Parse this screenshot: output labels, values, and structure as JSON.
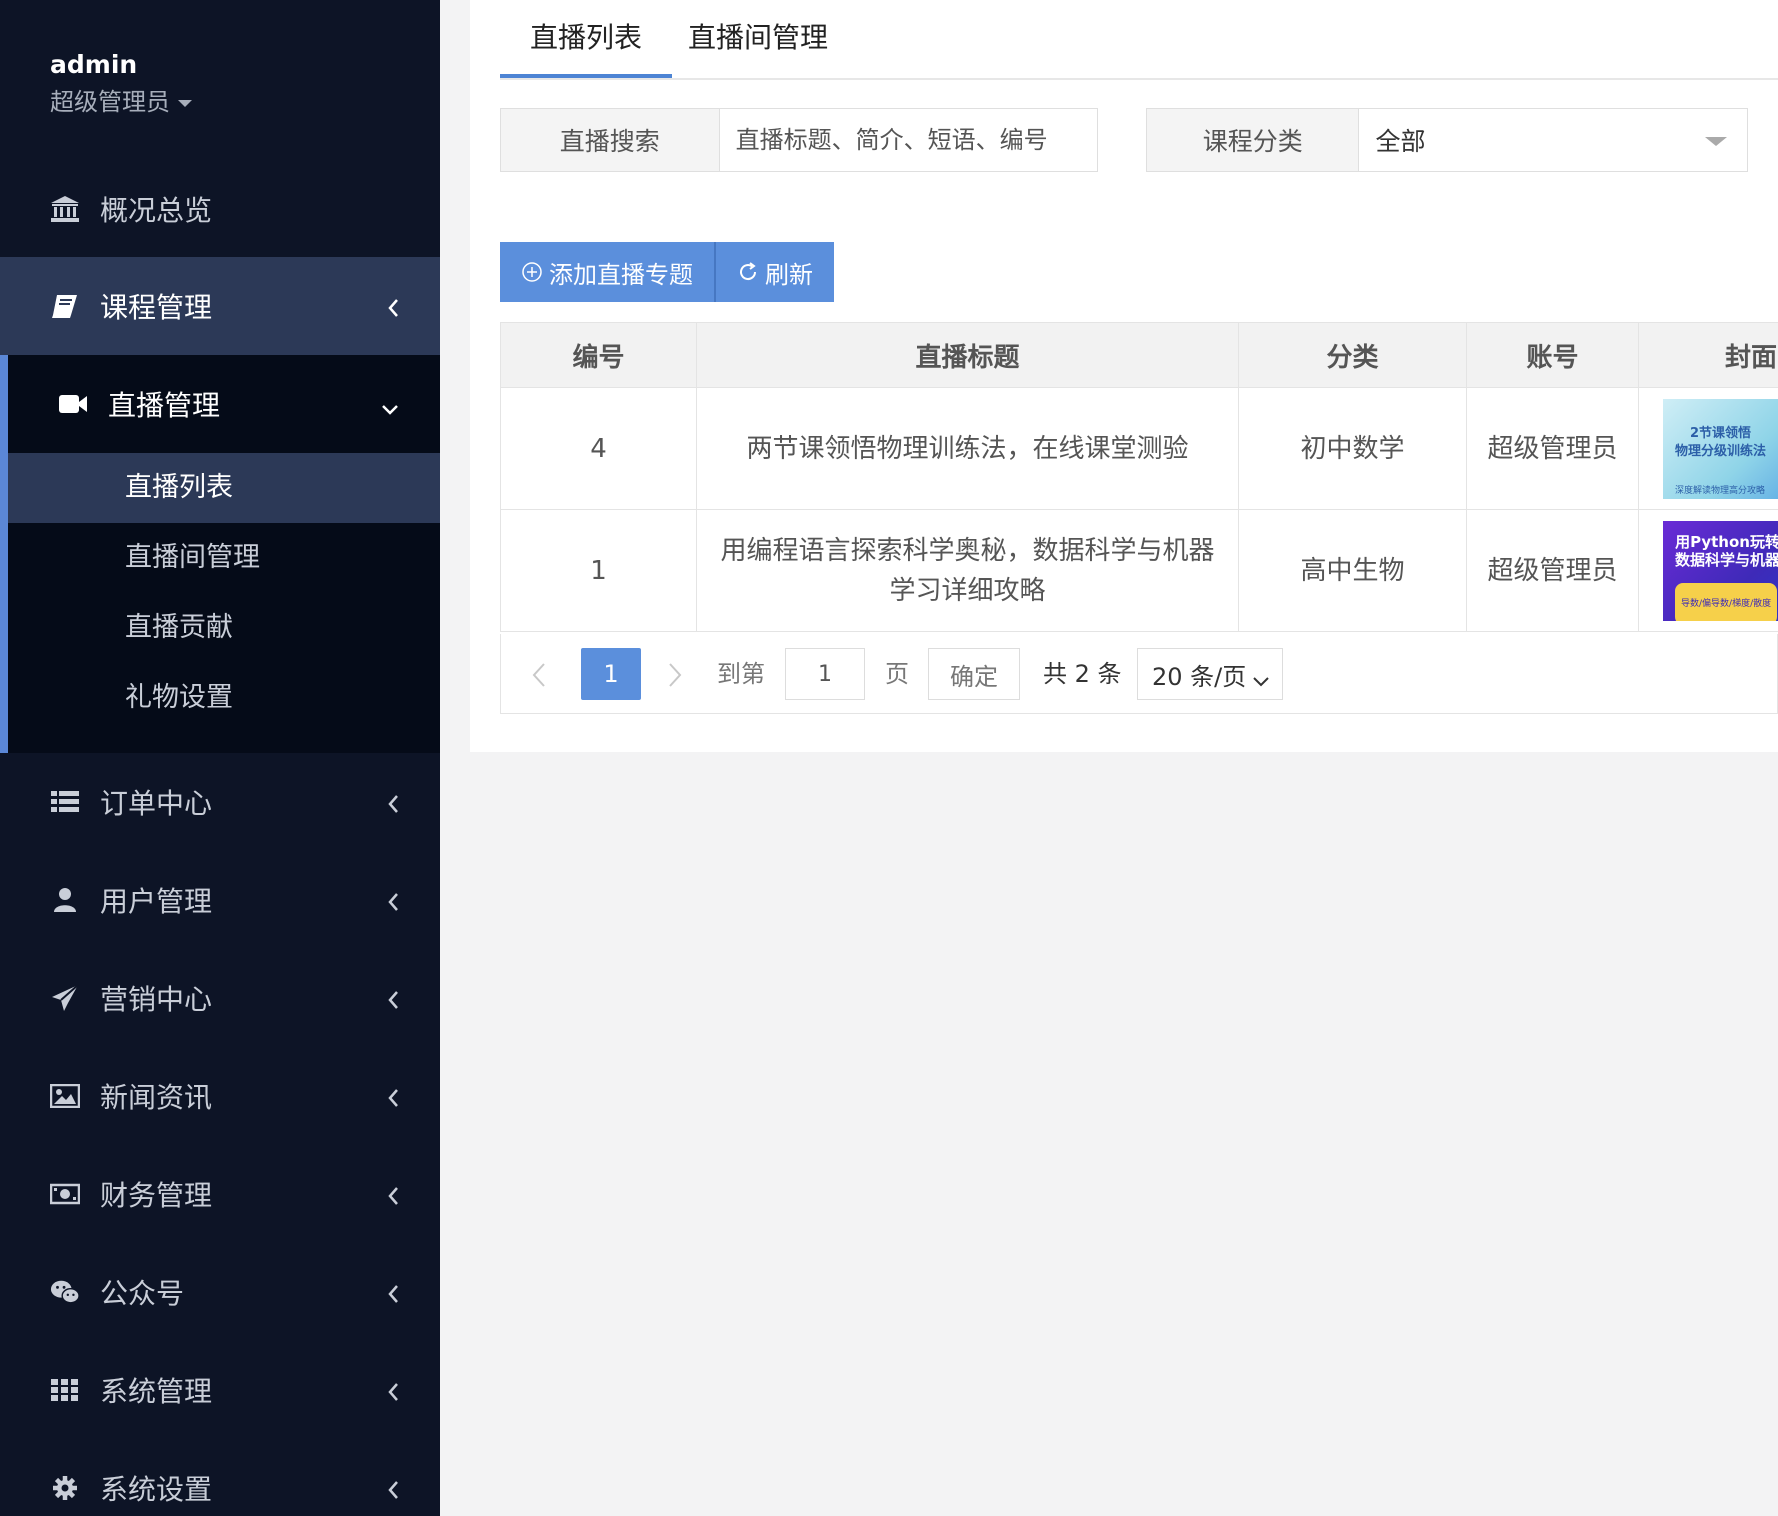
{
  "user": {
    "name": "admin",
    "role": "超级管理员"
  },
  "sidebar": {
    "items": [
      {
        "label": "概况总览",
        "icon": "bank-icon"
      },
      {
        "label": "课程管理",
        "icon": "book-icon"
      },
      {
        "label": "订单中心",
        "icon": "list-icon"
      },
      {
        "label": "用户管理",
        "icon": "user-icon"
      },
      {
        "label": "营销中心",
        "icon": "send-icon"
      },
      {
        "label": "新闻资讯",
        "icon": "image-icon"
      },
      {
        "label": "财务管理",
        "icon": "money-icon"
      },
      {
        "label": "公众号",
        "icon": "wechat-icon"
      },
      {
        "label": "系统管理",
        "icon": "grid-icon"
      },
      {
        "label": "系统设置",
        "icon": "gear-icon"
      }
    ],
    "live": {
      "label": "直播管理",
      "icon": "video-camera-icon",
      "children": [
        "直播列表",
        "直播间管理",
        "直播贡献",
        "礼物设置"
      ]
    }
  },
  "tabs": [
    "直播列表",
    "直播间管理"
  ],
  "search": {
    "label": "直播搜索",
    "placeholder": "直播标题、简介、短语、编号",
    "category_label": "课程分类",
    "category_value": "全部"
  },
  "actions": {
    "add": "添加直播专题",
    "refresh": "刷新"
  },
  "table": {
    "columns": [
      "编号",
      "直播标题",
      "分类",
      "账号",
      "封面"
    ],
    "rows": [
      {
        "id": "4",
        "title": "两节课领悟物理训练法，在线课堂测验",
        "category": "初中数学",
        "account": "超级管理员",
        "cover_lines": [
          "2节课领悟",
          "物理分级训练法",
          "深度解读物理高分攻略"
        ]
      },
      {
        "id": "1",
        "title": "用编程语言探索科学奥秘，数据科学与机器学习详细攻略",
        "category": "高中生物",
        "account": "超级管理员",
        "cover_lines": [
          "用Python玩转",
          "数据科学与机器",
          "导数/偏导数/梯度/散度"
        ]
      }
    ]
  },
  "pagination": {
    "current": "1",
    "goto_label": "到第",
    "goto_value": "1",
    "page_unit": "页",
    "confirm": "确定",
    "total": "共 2 条",
    "page_size": "20 条/页"
  },
  "colors": {
    "sidebar_bg": "#0d1426",
    "active_bg": "#2c3957",
    "accent": "#5b8fdc"
  }
}
